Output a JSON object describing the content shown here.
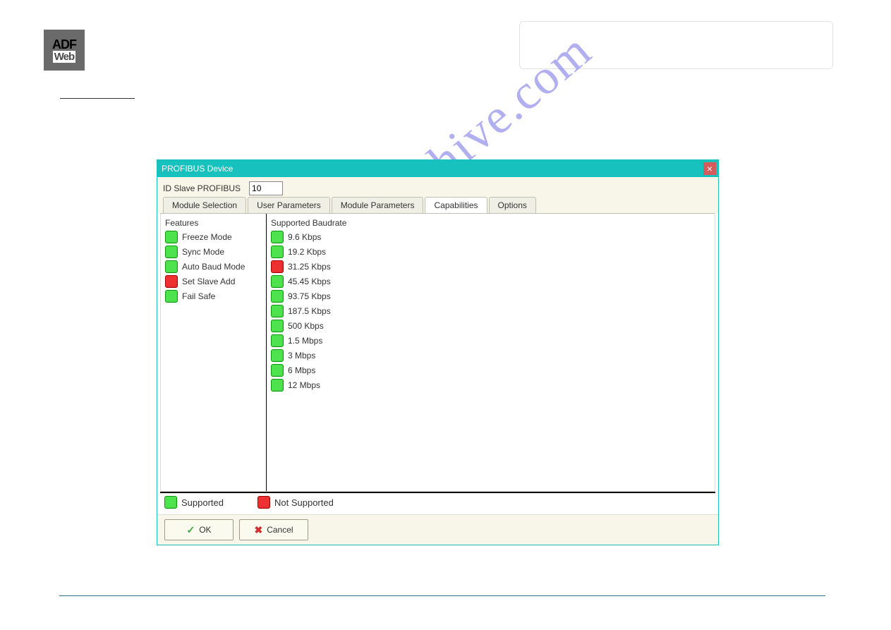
{
  "logo": {
    "top": "ADF",
    "bottom": "Web"
  },
  "dialog": {
    "title": "PROFIBUS Device",
    "id_slave_label": "ID Slave PROFIBUS",
    "id_slave_value": "10",
    "tabs": [
      {
        "label": "Module Selection",
        "active": false
      },
      {
        "label": "User Parameters",
        "active": false
      },
      {
        "label": "Module Parameters",
        "active": false
      },
      {
        "label": "Capabilities",
        "active": true
      },
      {
        "label": "Options",
        "active": false
      }
    ],
    "features_header": "Features",
    "features": [
      {
        "label": "Freeze Mode",
        "supported": true
      },
      {
        "label": "Sync Mode",
        "supported": true
      },
      {
        "label": "Auto Baud Mode",
        "supported": true
      },
      {
        "label": "Set Slave Add",
        "supported": false
      },
      {
        "label": "Fail Safe",
        "supported": true
      }
    ],
    "baud_header": "Supported Baudrate",
    "baudrates": [
      {
        "label": "9.6 Kbps",
        "supported": true
      },
      {
        "label": "19.2 Kbps",
        "supported": true
      },
      {
        "label": "31.25 Kbps",
        "supported": false
      },
      {
        "label": "45.45 Kbps",
        "supported": true
      },
      {
        "label": "93.75 Kbps",
        "supported": true
      },
      {
        "label": "187.5 Kbps",
        "supported": true
      },
      {
        "label": "500 Kbps",
        "supported": true
      },
      {
        "label": "1.5 Mbps",
        "supported": true
      },
      {
        "label": "3 Mbps",
        "supported": true
      },
      {
        "label": "6 Mbps",
        "supported": true
      },
      {
        "label": "12 Mbps",
        "supported": true
      }
    ],
    "legend": {
      "supported": "Supported",
      "not_supported": "Not Supported"
    },
    "buttons": {
      "ok": "OK",
      "cancel": "Cancel"
    }
  },
  "watermark": "manualshive.com"
}
